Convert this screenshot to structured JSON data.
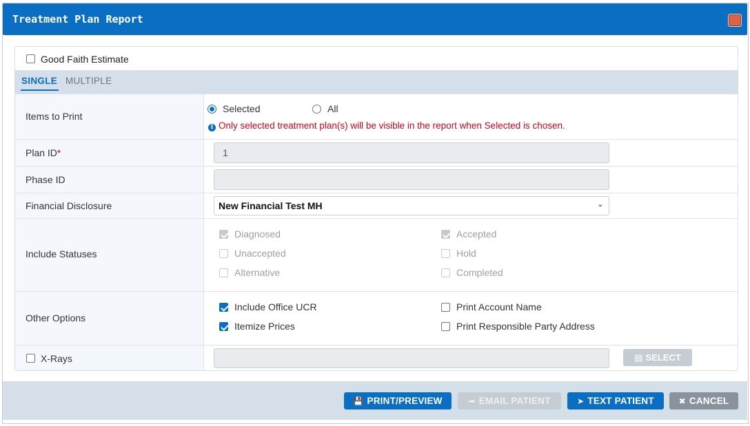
{
  "dialog": {
    "title": "Treatment Plan Report"
  },
  "good_faith_estimate": {
    "label": "Good Faith Estimate",
    "checked": false
  },
  "tabs": [
    {
      "label": "SINGLE",
      "active": true
    },
    {
      "label": "MULTIPLE",
      "active": false
    }
  ],
  "items_to_print": {
    "label": "Items to Print",
    "options": [
      {
        "label": "Selected",
        "checked": true
      },
      {
        "label": "All",
        "checked": false
      }
    ],
    "note": "Only selected treatment plan(s) will be visible in the report when Selected is chosen."
  },
  "plan_id": {
    "label": "Plan ID",
    "required_marker": "*",
    "value": "1"
  },
  "phase_id": {
    "label": "Phase ID",
    "value": ""
  },
  "financial_disclosure": {
    "label": "Financial Disclosure",
    "selected": "New Financial Test MH"
  },
  "include_statuses": {
    "label": "Include Statuses",
    "items": [
      {
        "label": "Diagnosed",
        "checked": true
      },
      {
        "label": "Accepted",
        "checked": true
      },
      {
        "label": "Unaccepted",
        "checked": false
      },
      {
        "label": "Hold",
        "checked": false
      },
      {
        "label": "Alternative",
        "checked": false
      },
      {
        "label": "Completed",
        "checked": false
      }
    ]
  },
  "other_options": {
    "label": "Other Options",
    "items": [
      {
        "label": "Include Office UCR",
        "checked": true
      },
      {
        "label": "Print Account Name",
        "checked": false
      },
      {
        "label": "Itemize Prices",
        "checked": true
      },
      {
        "label": "Print Responsible Party Address",
        "checked": false
      }
    ]
  },
  "xrays": {
    "label": "X-Rays",
    "checked": false,
    "value": "",
    "select_label": "SELECT"
  },
  "footer": {
    "print_preview": "PRINT/PREVIEW",
    "email_patient": "EMAIL PATIENT",
    "text_patient": "TEXT PATIENT",
    "cancel": "CANCEL"
  },
  "colors": {
    "primary": "#0a6fc2",
    "required": "#d0021b",
    "disabled_button": "#c5ccd4",
    "cancel_button": "#8a939d"
  }
}
